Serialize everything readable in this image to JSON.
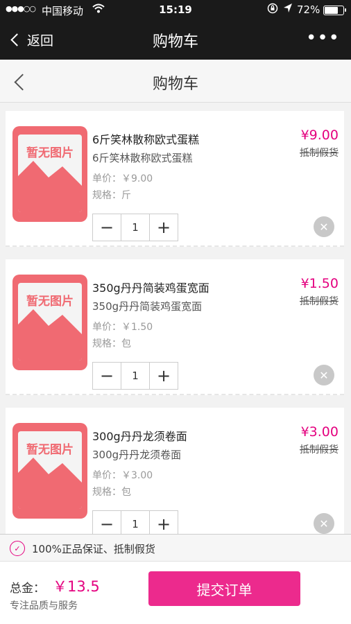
{
  "status_bar": {
    "signal": "●●●○○",
    "carrier": "中国移动",
    "time": "15:19",
    "battery_pct_text": "72%",
    "battery_level": 0.72
  },
  "nav": {
    "back_label": "返回",
    "title": "购物车",
    "more": "•••"
  },
  "page": {
    "title": "购物车"
  },
  "cart": {
    "items": [
      {
        "image_text": "暂无图片",
        "name": "6斤笑林散称欧式蛋糕",
        "subname": "6斤笑林散称欧式蛋糕",
        "unit_price": "单价：￥9.00",
        "spec": "规格：斤",
        "price": "¥9.00",
        "tag": "抵制假货",
        "qty": "1"
      },
      {
        "image_text": "暂无图片",
        "name": "350g丹丹简装鸡蛋宽面",
        "subname": "350g丹丹简装鸡蛋宽面",
        "unit_price": "单价：￥1.50",
        "spec": "规格：包",
        "price": "¥1.50",
        "tag": "抵制假货",
        "qty": "1"
      },
      {
        "image_text": "暂无图片",
        "name": "300g丹丹龙须卷面",
        "subname": "300g丹丹龙须卷面",
        "unit_price": "单价：￥3.00",
        "spec": "规格：包",
        "price": "¥3.00",
        "tag": "抵制假货",
        "qty": "1"
      }
    ],
    "minus": "−",
    "plus": "+",
    "remove": "✕"
  },
  "guarantee": {
    "text": "100%正品保证、抵制假货"
  },
  "footer": {
    "total_label": "总金：",
    "total_value": "￥13.5",
    "slogan": "专注品质与服务",
    "submit_label": "提交订单"
  },
  "colors": {
    "accent": "#e4007f",
    "button": "#ec2a8d",
    "placeholder": "#f06a72"
  }
}
